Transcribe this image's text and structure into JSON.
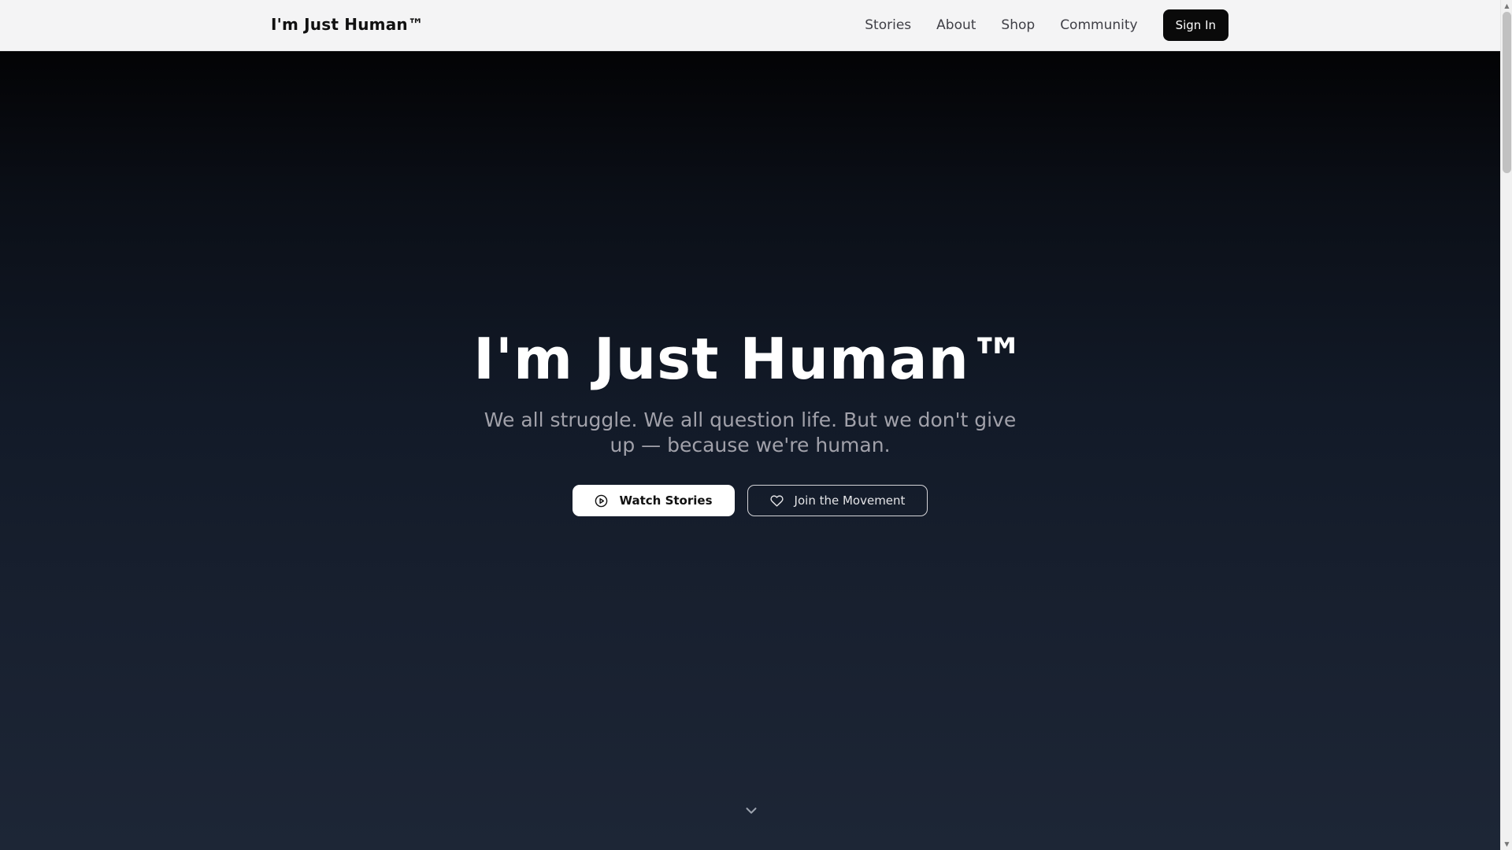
{
  "navbar": {
    "brand": "I'm Just Human™",
    "links": [
      {
        "label": "Stories"
      },
      {
        "label": "About"
      },
      {
        "label": "Shop"
      },
      {
        "label": "Community"
      }
    ],
    "signin_label": "Sign In"
  },
  "hero": {
    "title": "I'm Just Human™",
    "subtitle": "We all struggle. We all question life. But we don't give up — because we're human.",
    "primary_button": {
      "label": "Watch Stories",
      "icon": "play-circle-icon"
    },
    "secondary_button": {
      "label": "Join the Movement",
      "icon": "heart-icon"
    },
    "scroll_icon": "chevron-down-icon"
  },
  "colors": {
    "nav_bg": "#f4f4f5",
    "hero_top": "#030305",
    "hero_bottom": "#1d2636",
    "signin_bg": "#0a0a0a",
    "subtitle": "#a1a1aa"
  }
}
